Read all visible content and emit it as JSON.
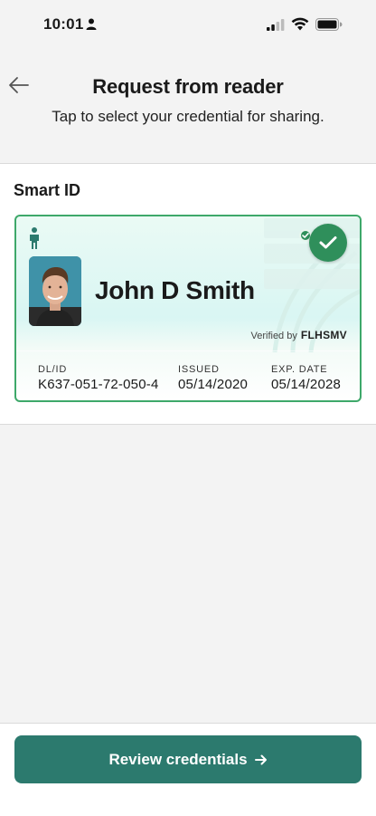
{
  "status_bar": {
    "time": "10:01",
    "icons": [
      "person-icon",
      "signal-icon",
      "wifi-icon",
      "battery-icon"
    ]
  },
  "header": {
    "back_icon": "arrow-left-icon",
    "title": "Request from reader",
    "subtitle": "Tap to select your credential for sharing."
  },
  "section": {
    "title": "Smart ID"
  },
  "card": {
    "name": "John D Smith",
    "verified_prefix": "Verified by",
    "verified_brand": "FLHSMV",
    "selected": true,
    "fields": {
      "dl_label": "DL/ID",
      "dl_value": "K637-051-72-050-4",
      "issued_label": "ISSUED",
      "issued_value": "05/14/2020",
      "exp_label": "EXP. DATE",
      "exp_value": "05/14/2028"
    }
  },
  "footer": {
    "button_label": "Review credentials",
    "button_icon": "arrow-right-icon"
  },
  "colors": {
    "accent": "#2c7a6e",
    "check_green": "#2f8f5b",
    "card_border": "#3ea86a",
    "background": "#f3f3f3"
  }
}
